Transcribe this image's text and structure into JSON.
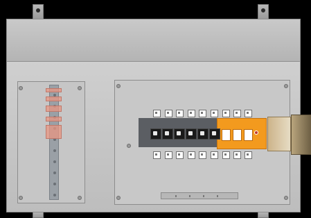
{
  "scene": {
    "description_items": [],
    "colors": {
      "enclosure": "#c4c4c4",
      "door_panel": "#c8c8c8",
      "din_rail": "#5b5e63",
      "breaker_orange": "#f39a1e",
      "pink_blocks": "#e89682",
      "background": "#000000"
    },
    "icons": {
      "mounting_tabs": "mounting-tab-icon",
      "breaker": "breaker-icon",
      "handle": "rotary-handle-icon"
    }
  }
}
